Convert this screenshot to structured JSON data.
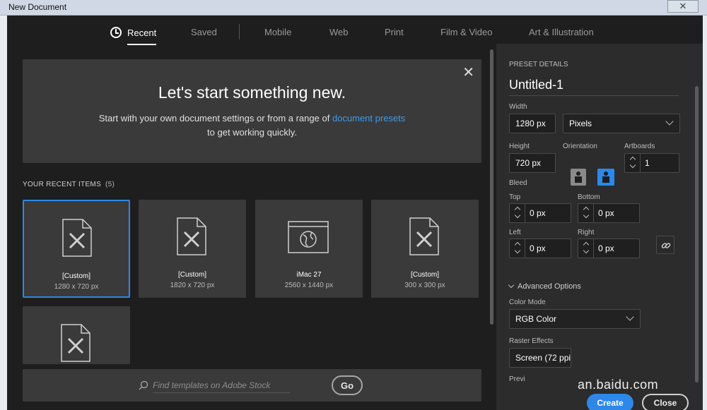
{
  "window": {
    "title": "New Document",
    "close": "✕"
  },
  "tabs": [
    {
      "label": "Recent"
    },
    {
      "label": "Saved"
    },
    {
      "label": "Mobile"
    },
    {
      "label": "Web"
    },
    {
      "label": "Print"
    },
    {
      "label": "Film & Video"
    },
    {
      "label": "Art & Illustration"
    }
  ],
  "hero": {
    "title": "Let's start something new.",
    "line1": "Start with your own document settings or from a range of",
    "link": "document presets",
    "line2": "to get working quickly.",
    "close": "✕"
  },
  "recent": {
    "label": "YOUR RECENT ITEMS",
    "count": "(5)",
    "items": [
      {
        "name": "[Custom]",
        "size": "1280 x 720 px",
        "icon": "document-icon"
      },
      {
        "name": "[Custom]",
        "size": "1820 x 720 px",
        "icon": "document-icon"
      },
      {
        "name": "iMac 27",
        "size": "2560 x 1440 px",
        "icon": "web-browser-icon"
      },
      {
        "name": "[Custom]",
        "size": "300 x 300 px",
        "icon": "document-icon"
      },
      {
        "name": "",
        "size": "",
        "icon": "document-icon"
      }
    ]
  },
  "search": {
    "placeholder": "Find templates on Adobe Stock",
    "go": "Go"
  },
  "preset": {
    "header": "PRESET DETAILS",
    "name": "Untitled-1",
    "width_label": "Width",
    "width": "1280 px",
    "unit": "Pixels",
    "height_label": "Height",
    "height": "720 px",
    "orientation_label": "Orientation",
    "artboards_label": "Artboards",
    "artboards": "1",
    "bleed_label": "Bleed",
    "top_label": "Top",
    "top": "0 px",
    "bottom_label": "Bottom",
    "bottom": "0 px",
    "left_label": "Left",
    "left": "0 px",
    "right_label": "Right",
    "right": "0 px",
    "advanced": "Advanced Options",
    "color_mode_label": "Color Mode",
    "color_mode": "RGB Color",
    "raster_label": "Raster Effects",
    "raster": "Screen (72 ppi",
    "preview_label": "Previ",
    "create": "Create",
    "close": "Close"
  },
  "watermark": "an.baidu.com",
  "colors": {
    "accent": "#2d88e8",
    "link": "#3d9bea",
    "panel": "#3a3a3a",
    "background": "#1e1e1e"
  }
}
